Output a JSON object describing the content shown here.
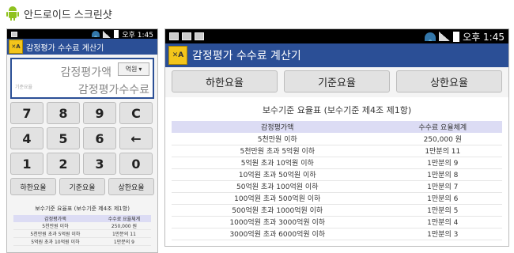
{
  "caption": "안드로이드 스크린샷",
  "status": {
    "time": "오후 1:45"
  },
  "app": {
    "title": "감정평가 수수료 계산기"
  },
  "calc": {
    "amount_label": "감정평가액",
    "unit": "억원",
    "fee_caption": "기준요율",
    "fee_label": "감정평가수수료",
    "keys": [
      "7",
      "8",
      "9",
      "C",
      "4",
      "5",
      "6",
      "←",
      "1",
      "2",
      "3",
      "0"
    ]
  },
  "rates": {
    "low": "하한요율",
    "base": "기준요율",
    "high": "상한요율"
  },
  "fee_table": {
    "title": "보수기준 요율표 (보수기준 제4조 제1항)",
    "headers": [
      "감정평가액",
      "수수료 요율체계"
    ],
    "rows": [
      [
        "5천만원 이하",
        "250,000 원"
      ],
      [
        "5천만원 초과 5억원 이하",
        "1만분의 11"
      ],
      [
        "5억원 초과 10억원 이하",
        "1만분의 9"
      ],
      [
        "10억원 초과 50억원 이하",
        "1만분의 8"
      ],
      [
        "50억원 초과 100억원 이하",
        "1만분의 7"
      ],
      [
        "100억원 초과 500억원 이하",
        "1만분의 6"
      ],
      [
        "500억원 초과 1000억원 이하",
        "1만분의 5"
      ],
      [
        "1000억원 초과 3000억원 이하",
        "1만분의 4"
      ],
      [
        "3000억원 초과 6000억원 이하",
        "1만분의 3"
      ]
    ]
  }
}
